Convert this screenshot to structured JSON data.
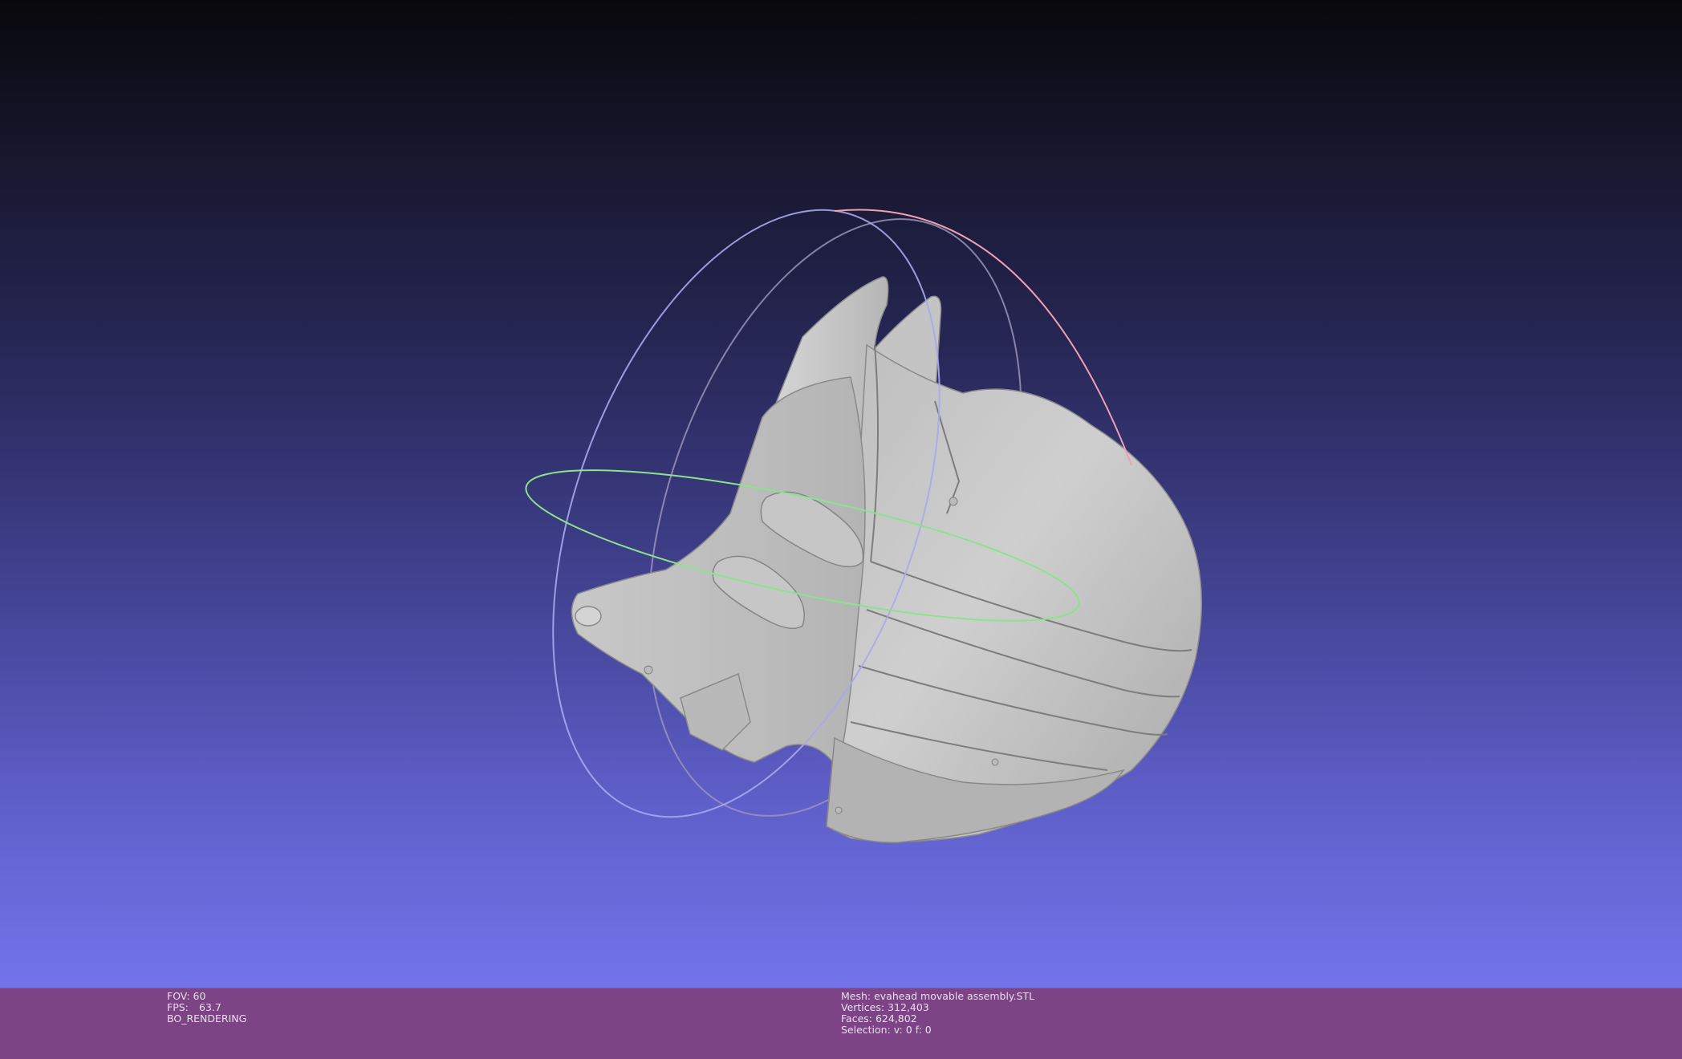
{
  "viewport": {
    "background_top": "#08080c",
    "background_bottom": "#7474ea",
    "trackball_colors": {
      "x_ring": "#8be38b",
      "y_ring": "#f0a0b0",
      "z_ring": "#a8a8f0",
      "inner_ring": "#9a94b8"
    },
    "mesh_color": "#c9c9c9"
  },
  "info_bar": {
    "background": "#7c4484",
    "left": {
      "fov": "FOV: 60",
      "fps_label": "FPS:",
      "fps_value": "63.7",
      "render_mode": "BO_RENDERING"
    },
    "right": {
      "mesh": "Mesh: evahead movable assembly.STL",
      "vertices": "Vertices: 312,403",
      "faces": "Faces: 624,802",
      "selection": "Selection: v: 0 f: 0"
    }
  }
}
